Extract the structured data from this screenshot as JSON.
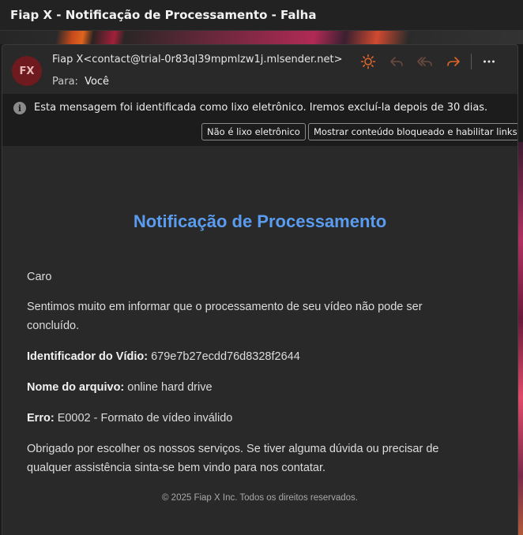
{
  "subject": "Fiap X - Notificação de Processamento - Falha",
  "sender": {
    "initials": "FX",
    "from": "Fiap X<contact@trial-0r83ql39mpmlzw1j.mlsender.net>",
    "to_label": "Para:",
    "to_value": "Você",
    "avatar_color": "#6e1a1e"
  },
  "toolbar": {
    "icons": [
      "sun-icon",
      "reply-icon",
      "reply-all-icon",
      "forward-icon",
      "more-icon"
    ],
    "accent": "#e0652a"
  },
  "junk_banner": {
    "message": "Esta mensagem foi identificada como lixo eletrônico. Iremos excluí-la depois de 30 dias.",
    "not_junk_label": "Não é lixo eletrônico",
    "show_content_label": "Mostrar conteúdo bloqueado e habilitar links"
  },
  "email_body": {
    "headline": "Notificação de Processamento",
    "headline_color": "#5a9cf0",
    "greeting": "Caro",
    "intro": "Sentimos muito em informar que o processamento de seu vídeo não pode ser concluído.",
    "id_label": "Identificador do Vídio:",
    "id_value": "679e7b27ecdd76d8328f2644",
    "filename_label": "Nome do arquivo:",
    "filename_value": "online hard drive",
    "error_label": "Erro:",
    "error_value": "E0002 - Formato de vídeo inválido",
    "closing": "Obrigado por escolher os nossos serviços. Se tiver alguma dúvida ou precisar de qualquer assistência sinta-se bem vindo para nos contatar.",
    "footer": "© 2025 Fiap X Inc. Todos os direitos reservados."
  }
}
